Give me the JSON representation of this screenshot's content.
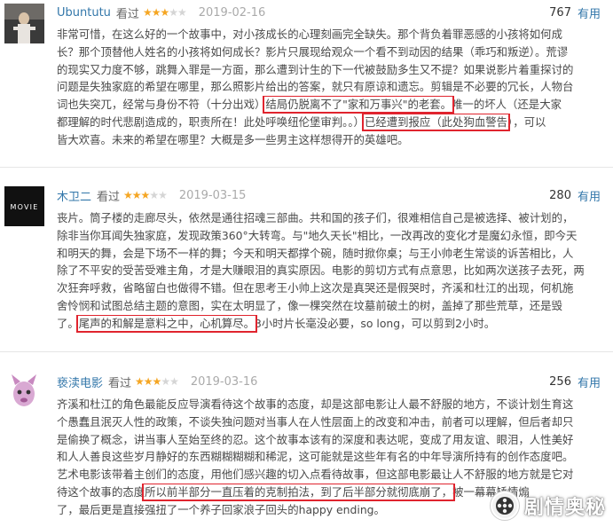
{
  "reviews": [
    {
      "user": "Ubuntutu",
      "watched": "看过",
      "stars": 3,
      "date": "2019-02-16",
      "votes": "767",
      "useful": "有用",
      "lines": [
        [
          "非常可惜，在这么好的一个故事中，对小孩成长的心理刻画完全缺失。那个背负着罪恶感的小孩将如何成"
        ],
        [
          "长？那个顶替他人姓名的小孩将如何成长？影片只展现给观众一个看不到动因的结果（乖巧和叛逆）。荒谬"
        ],
        [
          "的现实又力度不够，跳舞入罪是一方面，那么遭到计生的下一代被鼓励多生又不提？如果说影片着重探讨的"
        ],
        [
          "问题是失独家庭的希望在哪里，那么照影片给出的答案，就只有原谅和遗忘。剪辑是不必要的冗长，人物台"
        ],
        [
          "词也失突兀，经常与身份不符（十分出戏）",
          "结局仍脱离不了\"家和万事兴\"的老套。",
          "唯一的坏人（还是大家"
        ],
        [
          "都理解的时代悲剧造成的，职责所在！此处呼唤纽伦堡审判。。）",
          "已经遭到报应（此处狗血警告",
          "），可以"
        ],
        [
          "皆大欢喜。未来的希望在哪里？大概是多一些男主这样想得开的英雄吧。"
        ]
      ]
    },
    {
      "user": "木卫二",
      "watched": "看过",
      "stars": 3,
      "date": "2019-03-15",
      "votes": "280",
      "useful": "有用",
      "avatar_text": "MOVIE",
      "lines": [
        [
          "丧片。筒子楼的走廊尽头，依然是通往招魂三部曲。共和国的孩子们，很难相信自己是被选择、被计划的，"
        ],
        [
          "除非当你耳闻失独家庭，发现政策360°大转弯。与\"地久天长\"相比，一改再改的变化才是魔幻永恒，即今天"
        ],
        [
          "和明天的舞，会是下场不一样的舞；今天和明天都撑个碗，随时掀你桌；与王小帅老生常谈的诉苦相比，人"
        ],
        [
          "除了不平安的受苦受难主角，才是大赚眼泪的真实原因。电影的剪切方式有点意思，比如两次送孩子去死，两"
        ],
        [
          "次狂奔呼救，省略留白也做得不错。但在思考王小帅上这次是真哭还是假哭时，齐溪和杜江的出现，何机施"
        ],
        [
          "舍怜悯和试图总结主题的意图，实在太明显了，像一棵突然在坟墓前破土的树，盖掉了那些荒草，还是毁"
        ],
        [
          "了。",
          "尾声的和解是意料之中，心机算尽。",
          "3小时片长毫没必要，so long，可以剪到2小时。"
        ]
      ]
    },
    {
      "user": "亵渎电影",
      "watched": "看过",
      "stars": 3,
      "date": "2019-03-16",
      "votes": "256",
      "useful": "有用",
      "lines": [
        [
          "齐溪和杜江的角色最能反应导演看待这个故事的态度，却是这部电影让人最不舒服的地方，不谈计划生育这"
        ],
        [
          "个愚蠢且泯灭人性的政策，不谈失独问题对当事人在人性层面上的改变和冲击，前者可以理解，但后者却只"
        ],
        [
          "是偷换了概念，讲当事人至始至终的忍。这个故事本该有的深度和表达呢，变成了用友谊、眼泪，人性美好"
        ],
        [
          "和人人善良这些岁月静好的东西糊糊糊糊和稀泥，这可能就是这些年有名的中年导演所持有的创作态度吧。"
        ],
        [
          "艺术电影该带着主创们的态度，用他们感兴趣的切入点看待故事，但这部电影最让人不舒服的地方就是它对"
        ],
        [
          "待这个故事的态度",
          "所以前半部分一直压着的克制拍法，到了后半部分就彻底崩了，",
          "被一幕幕矫情煽"
        ],
        [
          "了，最后更是直接强扭了一个养子回家浪子回头的happy ending。"
        ]
      ]
    }
  ],
  "watermark": {
    "text": "剧情奥秘",
    "icon": "film-reel-icon"
  },
  "colors": {
    "link": "#3377aa",
    "star": "#f5a623",
    "highlight": "#e0242e"
  }
}
